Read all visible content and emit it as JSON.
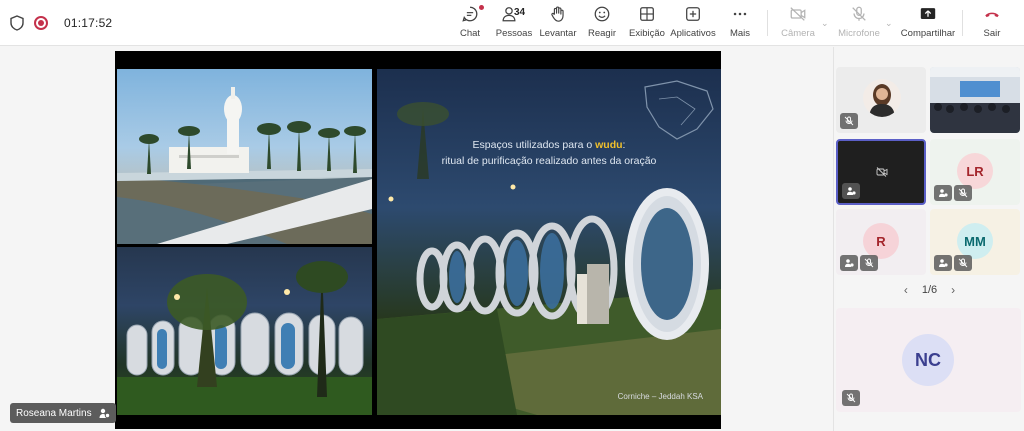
{
  "meeting": {
    "timer": "01:17:52"
  },
  "toolbar": {
    "chat": "Chat",
    "people": "Pessoas",
    "people_count": "34",
    "raise": "Levantar",
    "react": "Reagir",
    "view": "Exibição",
    "apps": "Aplicativos",
    "more": "Mais",
    "camera": "Câmera",
    "mic": "Microfone",
    "share": "Compartilhar",
    "leave": "Sair"
  },
  "colors": {
    "accent": "#5b5fc7",
    "leave": "#c4314b",
    "record": "#c4314b"
  },
  "slide": {
    "title_before": "Espaços utilizados para o ",
    "title_highlight": "wudu",
    "title_after": ":",
    "subtitle": "ritual de purificação realizado antes da oração",
    "caption": "Corniche – Jeddah KSA"
  },
  "presenter": {
    "name": "Roseana Martins"
  },
  "participants": [
    {
      "initials": "LR"
    },
    {
      "initials": "R"
    },
    {
      "initials": "MM"
    },
    {
      "initials": "NC"
    }
  ],
  "pager": {
    "label": "1/6"
  }
}
